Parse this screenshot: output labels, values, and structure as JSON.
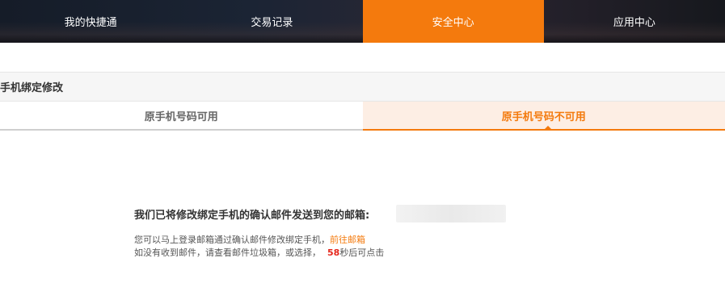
{
  "topnav": {
    "items": [
      {
        "label": "我的快捷通",
        "active": false
      },
      {
        "label": "交易记录",
        "active": false
      },
      {
        "label": "安全中心",
        "active": true
      },
      {
        "label": "应用中心",
        "active": false
      }
    ]
  },
  "section": {
    "title": "手机绑定修改"
  },
  "tabs": [
    {
      "label": "原手机号码可用",
      "active": false
    },
    {
      "label": "原手机号码不可用",
      "active": true
    }
  ],
  "message": {
    "title": "我们已将修改绑定手机的确认邮件发送到您的邮箱:",
    "line1_text": "您可以马上登录邮箱通过确认邮件修改绑定手机，",
    "line1_link": "前往邮箱",
    "line2_text": "如没有收到邮件，请查看邮件垃圾箱，或选择，",
    "countdown_number": "58",
    "countdown_suffix": "秒后可点击"
  },
  "colors": {
    "accent": "#f47a0d",
    "countdown": "#e5261b",
    "tab_active_bg": "#fdeee4"
  }
}
